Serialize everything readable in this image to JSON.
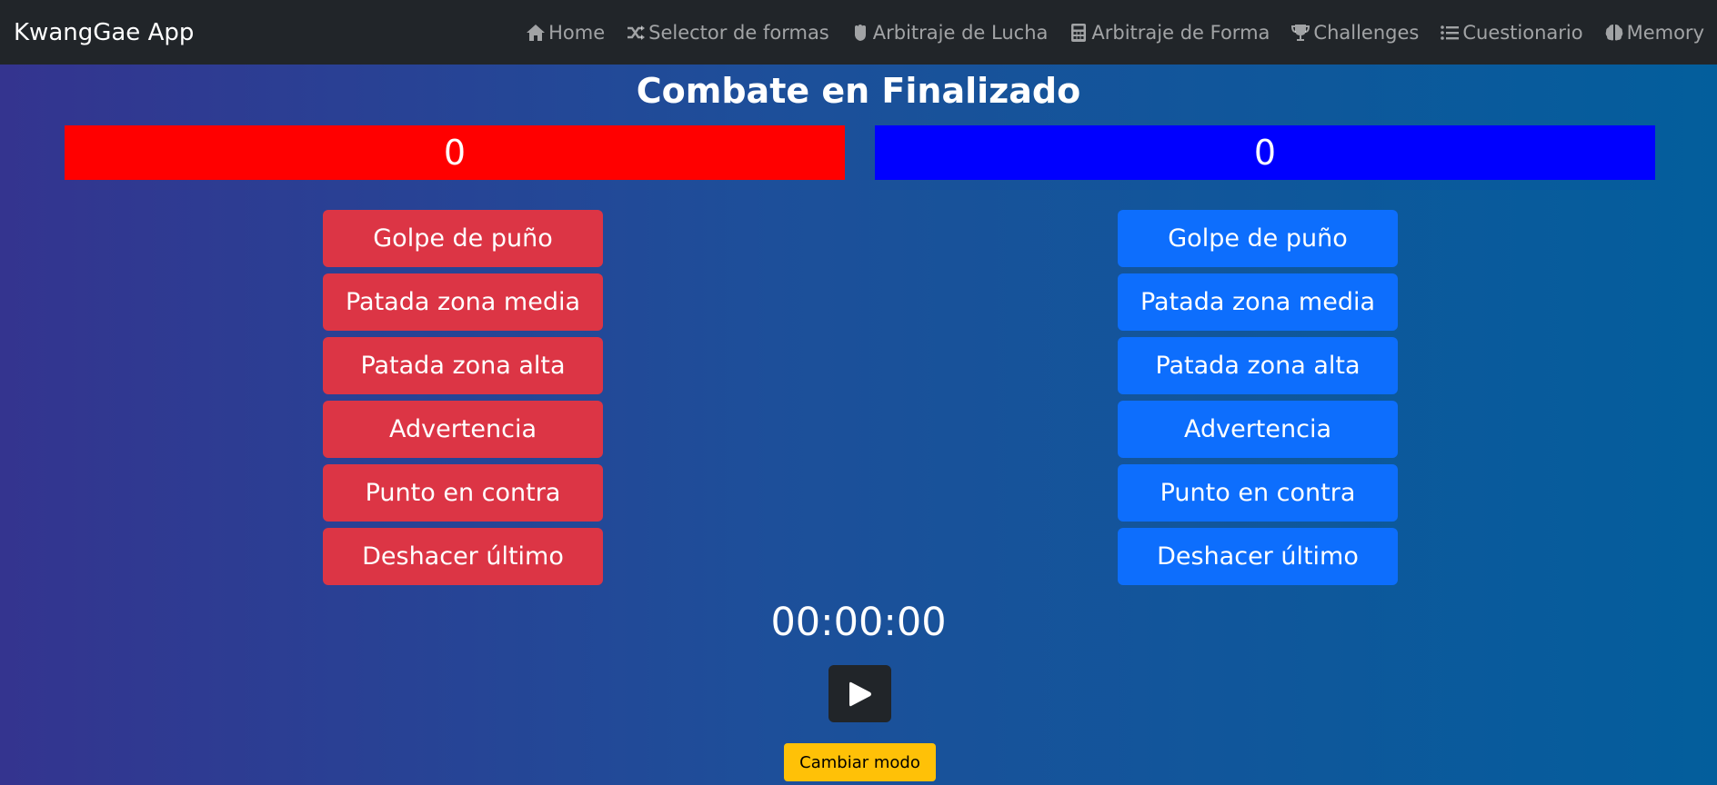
{
  "nav": {
    "brand": "KwangGae App",
    "items": [
      {
        "label": "Home",
        "icon": "home-icon"
      },
      {
        "label": "Selector de formas",
        "icon": "shuffle-icon"
      },
      {
        "label": "Arbitraje de Lucha",
        "icon": "fist-icon"
      },
      {
        "label": "Arbitraje de Forma",
        "icon": "calculator-icon"
      },
      {
        "label": "Challenges",
        "icon": "trophy-icon"
      },
      {
        "label": "Cuestionario",
        "icon": "list-icon"
      },
      {
        "label": "Memory",
        "icon": "brain-icon"
      }
    ]
  },
  "main": {
    "title": "Combate en Finalizado",
    "red_score": "0",
    "blue_score": "0",
    "colors": {
      "red_score_bg": "#ff0000",
      "blue_score_bg": "#0000ff",
      "red_button": "#dc3545",
      "blue_button": "#0d6efd"
    },
    "actions": [
      "Golpe de puño",
      "Patada zona media",
      "Patada zona alta",
      "Advertencia",
      "Punto en contra",
      "Deshacer último"
    ],
    "timer": "00:00:00",
    "play_icon": "play-icon",
    "mode_button": "Cambiar modo"
  }
}
